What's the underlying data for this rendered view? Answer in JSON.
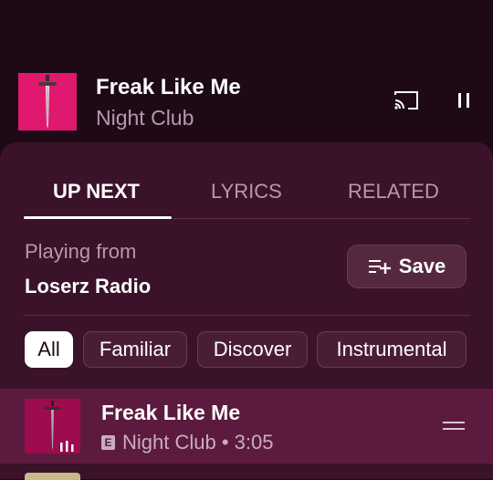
{
  "now_playing": {
    "title": "Freak Like Me",
    "subtitle": "Night Club",
    "cast_icon": "cast-icon",
    "pause_icon": "pause-icon"
  },
  "tabs": [
    {
      "label": "UP NEXT",
      "active": true
    },
    {
      "label": "LYRICS",
      "active": false
    },
    {
      "label": "RELATED",
      "active": false
    }
  ],
  "queue": {
    "playing_from_label": "Playing from",
    "station": "Loserz Radio",
    "save_label": "Save",
    "save_icon": "playlist-add-icon"
  },
  "chips": [
    {
      "label": "All",
      "selected": true
    },
    {
      "label": "Familiar",
      "selected": false
    },
    {
      "label": "Discover",
      "selected": false
    },
    {
      "label": "Instrumental",
      "selected": false
    }
  ],
  "tracks": [
    {
      "title": "Freak Like Me",
      "explicit_badge": "E",
      "meta": "Night Club • 3:05",
      "playing": true
    }
  ],
  "colors": {
    "background": "#1e0a17",
    "sheet": "#3a1229",
    "active_row": "#5c1b3e",
    "album_art": "#e0186f"
  }
}
